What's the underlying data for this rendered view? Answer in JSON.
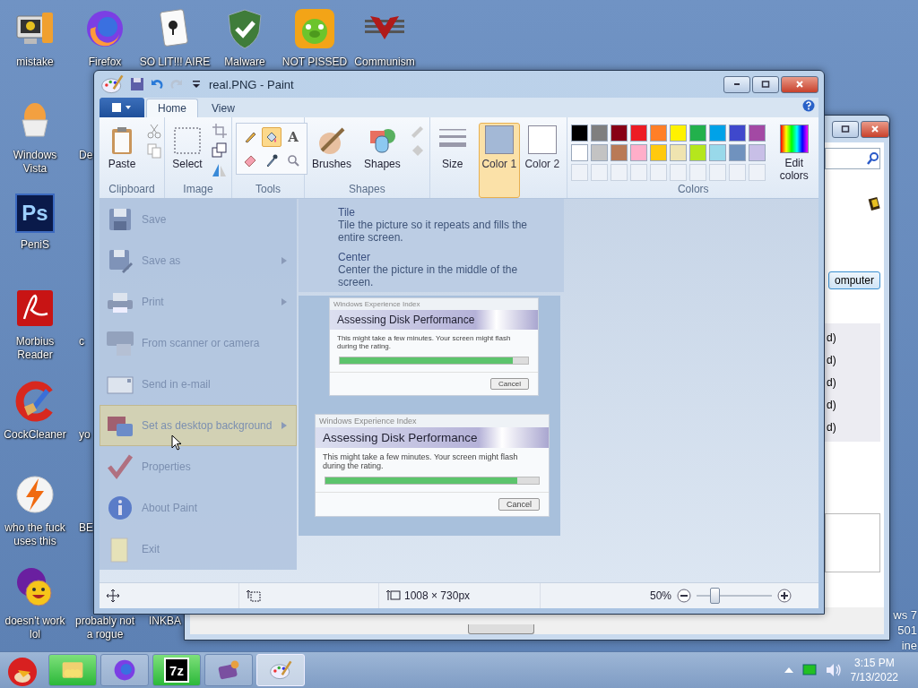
{
  "desktop_icons": [
    {
      "label": "mistake",
      "kind": "computer"
    },
    {
      "label": "Firefox",
      "kind": "firefox"
    },
    {
      "label": "SO LIT!!! AIRE",
      "kind": "cards"
    },
    {
      "label": "Malware",
      "kind": "shield"
    },
    {
      "label": "NOT PISSED",
      "kind": "pig"
    },
    {
      "label": "Communism",
      "kind": "emblem"
    },
    {
      "label": "Windows Vista",
      "kind": "egg"
    },
    {
      "label": "De",
      "kind": "covered"
    },
    {
      "label": "PeniS",
      "kind": "ps",
      "glyph": "Ps"
    },
    {
      "label": "Morbius Reader",
      "kind": "acrobat"
    },
    {
      "label": "c",
      "kind": "covered"
    },
    {
      "label": "CockCleaner",
      "kind": "cleaner"
    },
    {
      "label": "yo",
      "kind": "covered"
    },
    {
      "label": "who the fuck uses this",
      "kind": "bolt"
    },
    {
      "label": "BE",
      "kind": "covered"
    },
    {
      "label": "doesn't work lol",
      "kind": "messenger"
    },
    {
      "label": "probably not a rogue",
      "kind": "document"
    },
    {
      "label": "INKBA",
      "kind": "covered"
    }
  ],
  "back_window": {
    "button": "omputer",
    "list_items": [
      "d)",
      "d)",
      "d)",
      "d)",
      "d)"
    ]
  },
  "desktop_notice": [
    "ws 7",
    "501",
    "ine"
  ],
  "paint": {
    "title": "real.PNG - Paint",
    "tabs": [
      {
        "label": "Home",
        "selected": true
      },
      {
        "label": "View",
        "selected": false
      }
    ],
    "clipboard": {
      "paste": "Paste",
      "label": "Clipboard"
    },
    "image": {
      "select": "Select",
      "label": "Image"
    },
    "tools": {
      "label": "Tools",
      "items": [
        {
          "kind": "pencil",
          "selected": false
        },
        {
          "kind": "fill",
          "selected": true
        },
        {
          "kind": "text",
          "glyph": "A",
          "selected": false
        },
        {
          "kind": "eraser",
          "selected": false
        },
        {
          "kind": "picker",
          "selected": false
        },
        {
          "kind": "magnifier",
          "selected": false
        }
      ]
    },
    "shapes": {
      "brushes": "Brushes",
      "shapes": "Shapes",
      "label": "Shapes"
    },
    "size": "Size",
    "color_slots": [
      {
        "label": "Color 1",
        "color": "#a3b8d6",
        "selected": true
      },
      {
        "label": "Color 2",
        "color": "#ffffff",
        "selected": false
      }
    ],
    "colors": {
      "label": "Colors",
      "edit": "Edit colors",
      "swatches": [
        {
          "color": "#000000"
        },
        {
          "color": "#7f7f7f"
        },
        {
          "color": "#880015"
        },
        {
          "color": "#ed1c24"
        },
        {
          "color": "#ff7f27"
        },
        {
          "color": "#fff200"
        },
        {
          "color": "#22b14c"
        },
        {
          "color": "#00a2e8"
        },
        {
          "color": "#3f48cc"
        },
        {
          "color": "#a349a4"
        },
        {
          "color": "#ffffff"
        },
        {
          "color": "#c3c3c3"
        },
        {
          "color": "#b97a57"
        },
        {
          "color": "#ffaec9"
        },
        {
          "color": "#ffc90e"
        },
        {
          "color": "#efe4b0"
        },
        {
          "color": "#b5e61d"
        },
        {
          "color": "#99d9ea"
        },
        {
          "color": "#7092be"
        },
        {
          "color": "#c8bfe7"
        }
      ]
    },
    "file_menu": [
      {
        "label": "Save",
        "kind": "save",
        "submenu": false,
        "selected": false
      },
      {
        "label": "Save as",
        "kind": "saveas",
        "submenu": true,
        "selected": false
      },
      {
        "label": "Print",
        "kind": "print",
        "submenu": true,
        "selected": false
      },
      {
        "label": "From scanner or camera",
        "kind": "scanner",
        "submenu": false,
        "selected": false
      },
      {
        "label": "Send in e-mail",
        "kind": "email",
        "submenu": false,
        "selected": false
      },
      {
        "label": "Set as desktop background",
        "kind": "desktop",
        "submenu": true,
        "selected": true
      },
      {
        "label": "Properties",
        "kind": "properties",
        "submenu": false,
        "selected": false
      },
      {
        "label": "About Paint",
        "kind": "about",
        "submenu": false,
        "selected": false
      },
      {
        "label": "Exit",
        "kind": "exit",
        "submenu": false,
        "selected": false
      }
    ],
    "submenu": [
      {
        "title": "Tile",
        "description": "Tile the picture so it repeats and fills the entire screen."
      },
      {
        "title": "Center",
        "description": "Center the picture in the middle of the screen."
      }
    ],
    "picture_dialogs": [
      {
        "caption": "Windows Experience Index",
        "heading": "Assessing Disk Performance",
        "message": "This might take a few minutes. Your screen might flash during the rating.",
        "level": 0.92,
        "button": "Cancel"
      },
      {
        "caption": "Windows Experience Index",
        "heading": "Assessing Disk Performance",
        "message": "This might take a few minutes. Your screen might flash during the rating.",
        "level": 0.9,
        "button": "Cancel"
      }
    ],
    "status": {
      "image_size": "1008 × 730px",
      "zoom": "50%",
      "zoom_slider": {
        "level": 0.24
      }
    }
  },
  "taskbar": [
    {
      "kind": "folder",
      "flashing": true,
      "selected": false
    },
    {
      "kind": "firefox",
      "flashing": false,
      "selected": false
    },
    {
      "kind": "sevenzip",
      "glyph": "7z",
      "flashing": true,
      "selected": false
    },
    {
      "kind": "app",
      "flashing": false,
      "selected": false
    },
    {
      "kind": "paint",
      "flashing": false,
      "selected": true
    }
  ],
  "clock": {
    "time": "3:15 PM",
    "date": "7/13/2022"
  }
}
